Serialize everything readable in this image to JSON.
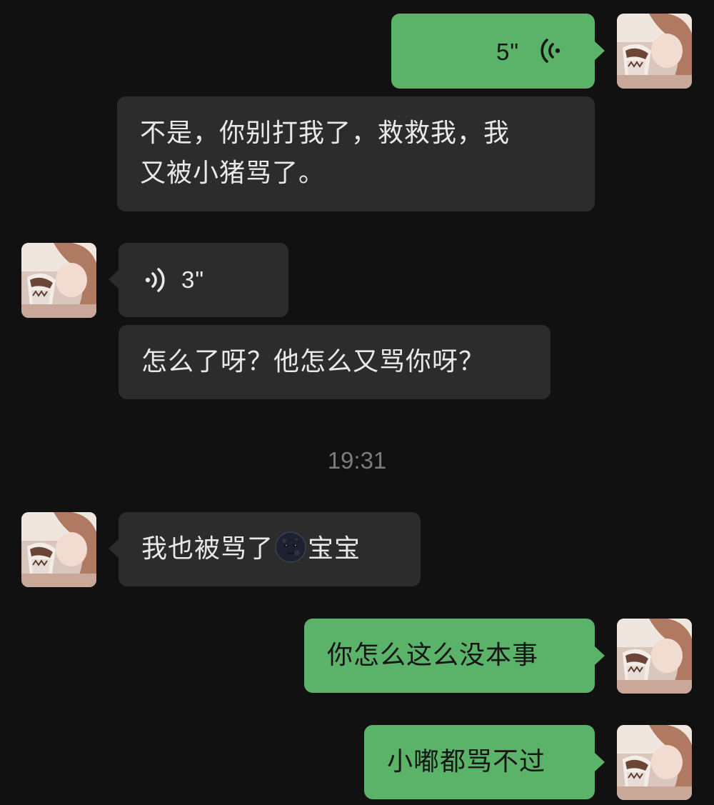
{
  "messages": {
    "m1": {
      "side": "right",
      "type": "voice",
      "duration": "5\"",
      "icon": "voice-wave-icon"
    },
    "m2": {
      "side": "right",
      "type": "text",
      "text_line1": "不是，你别打我了，救救我，我",
      "text_line2": "又被小猪骂了。"
    },
    "m3": {
      "side": "left",
      "type": "voice",
      "duration": "3\"",
      "icon": "voice-wave-icon"
    },
    "m4": {
      "side": "left",
      "type": "text",
      "text": "怎么了呀？他怎么又骂你呀？"
    },
    "m5": {
      "side": "left",
      "type": "text",
      "text_before": "我也被骂了",
      "emoji": "new-moon-face-emoji",
      "text_after": "宝宝"
    },
    "m6": {
      "side": "right",
      "type": "text",
      "text": "你怎么这么没本事"
    },
    "m7": {
      "side": "right",
      "type": "text",
      "text": "小嘟都骂不过"
    }
  },
  "timestamp": "19:31",
  "colors": {
    "background": "#111111",
    "incoming_bubble": "#2c2c2c",
    "outgoing_bubble": "#5bb36a",
    "timestamp": "#7c7c7c"
  }
}
